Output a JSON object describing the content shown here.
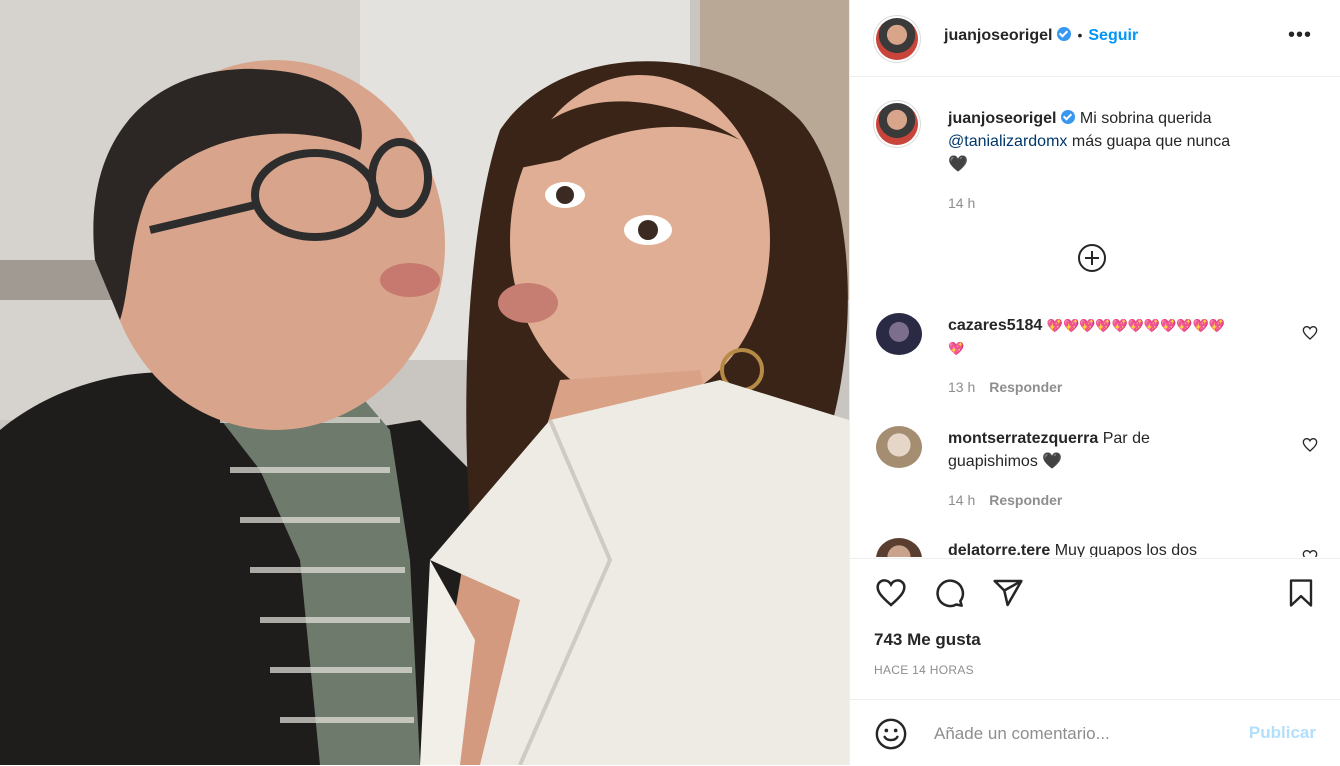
{
  "post": {
    "author": "juanjoseorigel",
    "follow_label": "Seguir",
    "separator": "•",
    "more_label": "•••"
  },
  "caption": {
    "author": "juanjoseorigel",
    "text_before": "Mi sobrina querida",
    "mention": "@tanializardomx",
    "text_after": "más guapa que nunca",
    "emoji": "🖤",
    "time": "14 h"
  },
  "comments": [
    {
      "user": "cazares5184",
      "text": "💖💖💖💖💖💖💖💖💖💖💖",
      "text2": "💖",
      "time": "13 h",
      "reply": "Responder"
    },
    {
      "user": "montserratezquerra",
      "text": "Par de",
      "text2": "guapishimos 🖤",
      "time": "14 h",
      "reply": "Responder"
    },
    {
      "user": "delatorre.tere",
      "text": "Muy guapos los dos"
    }
  ],
  "stats": {
    "likes": "743 Me gusta",
    "posted": "HACE 14 HORAS"
  },
  "composer": {
    "placeholder": "Añade un comentario...",
    "publish": "Publicar"
  },
  "colors": {
    "link": "#0095f6",
    "verified": "#3897f0",
    "muted": "#8e8e8e",
    "publish_disabled": "#b2dffc"
  },
  "icons": [
    "heart-icon",
    "comment-icon",
    "share-icon",
    "bookmark-icon",
    "emoji-icon",
    "plus-circle-icon",
    "verified-badge-icon"
  ]
}
